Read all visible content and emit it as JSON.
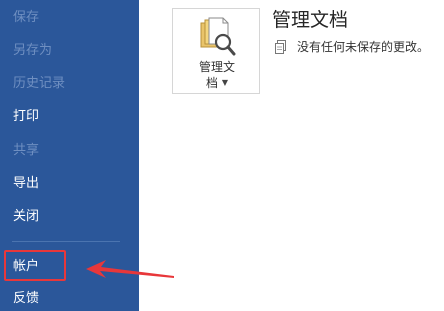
{
  "sidebar": {
    "items": [
      {
        "label": "保存",
        "enabled": false
      },
      {
        "label": "另存为",
        "enabled": false
      },
      {
        "label": "历史记录",
        "enabled": false
      },
      {
        "label": "打印",
        "enabled": true
      },
      {
        "label": "共享",
        "enabled": false
      },
      {
        "label": "导出",
        "enabled": true
      },
      {
        "label": "关闭",
        "enabled": true
      },
      {
        "label": "帐户",
        "enabled": true,
        "highlighted": true
      },
      {
        "label": "反馈",
        "enabled": true
      }
    ]
  },
  "main": {
    "manage_tile": {
      "label_line1": "管理文",
      "label_line2": "档",
      "icon": "document-search-icon"
    },
    "section_title": "管理文档",
    "status_text": "没有任何未保存的更改。",
    "status_icon": "documents-icon"
  },
  "colors": {
    "sidebar_bg": "#2b579a",
    "highlight": "#e8373a",
    "disabled_text": "#6f8fc1"
  }
}
